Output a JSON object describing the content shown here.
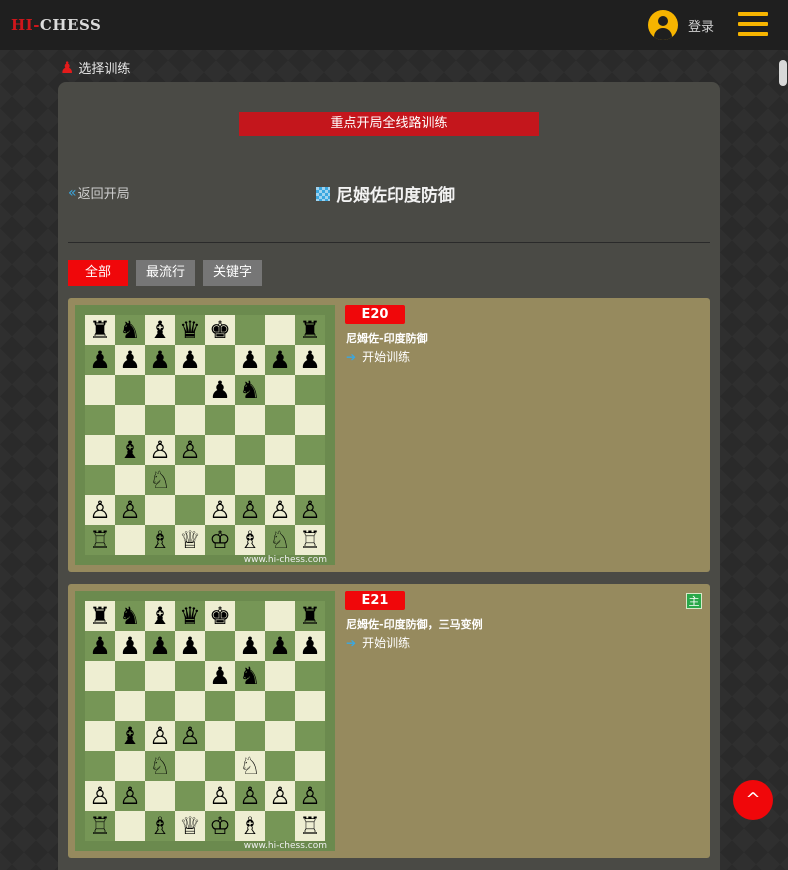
{
  "header": {
    "logo_hi": "HI-",
    "logo_chess": "CHESS",
    "login_label": "登录",
    "user_icon": "user-circle-icon",
    "menu_icon": "hamburger-menu-icon"
  },
  "breadcrumb": {
    "label": "选择训练",
    "icon": "pawn-icon"
  },
  "banner": {
    "label": "重点开局全线路训练"
  },
  "nav": {
    "back_label": "返回开局",
    "back_icon": "double-chevron-left-icon"
  },
  "page_title": "尼姆佐印度防御",
  "filters": [
    {
      "label": "全部",
      "active": true
    },
    {
      "label": "最流行",
      "active": false
    },
    {
      "label": "关键字",
      "active": false
    }
  ],
  "cards": [
    {
      "eco": "E20",
      "name": "尼姆佐-印度防御",
      "start_label": "开始训练",
      "main_badge": "",
      "watermark": "www.hi-chess.com",
      "board": [
        "♜♞♝♛♚..♜",
        "♟♟♟♟.♟♟♟",
        "....♟♞..",
        "........",
        ".♝♙♙....",
        "..♘.....",
        "♙♙..♙♙♙♙",
        "♖.♗♕♔♗♘♖"
      ]
    },
    {
      "eco": "E21",
      "name": "尼姆佐-印度防御，三马变例",
      "start_label": "开始训练",
      "main_badge": "主",
      "watermark": "www.hi-chess.com",
      "board": [
        "♜♞♝♛♚..♜",
        "♟♟♟♟.♟♟♟",
        "....♟♞..",
        "........",
        ".♝♙♙....",
        "..♘..♘..",
        "♙♙..♙♙♙♙",
        "♖.♗♕♔♗.♖"
      ]
    }
  ],
  "scroll_top": {
    "label": "^",
    "icon": "chevron-up-icon"
  },
  "colors": {
    "brand_red": "#f0070a",
    "accent_yellow": "#f6b400",
    "link_blue": "#3aa7e0",
    "card_bg": "#968a5e"
  }
}
